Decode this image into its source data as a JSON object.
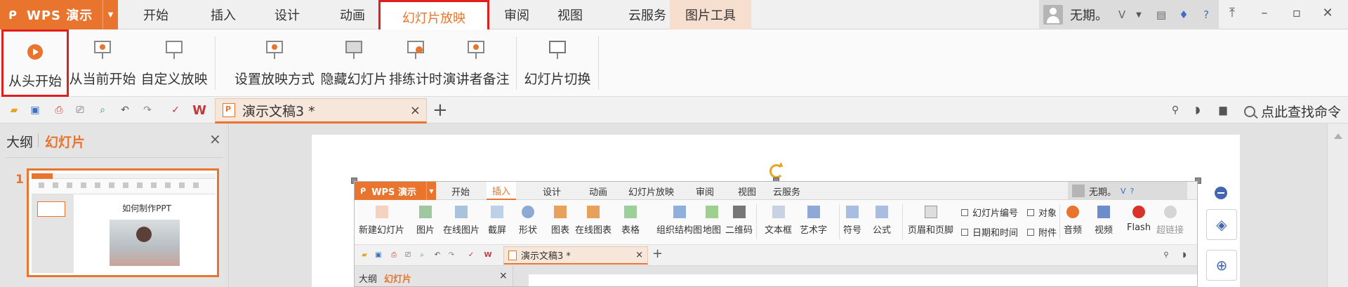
{
  "app": {
    "name": "WPS 演示",
    "logo": "wps-logo-icon"
  },
  "menu": {
    "tabs": [
      {
        "label": "开始"
      },
      {
        "label": "插入"
      },
      {
        "label": "设计"
      },
      {
        "label": "动画"
      },
      {
        "label": "幻灯片放映",
        "active": true
      },
      {
        "label": "审阅"
      },
      {
        "label": "视图"
      },
      {
        "label": "云服务"
      },
      {
        "label": "图片工具",
        "contextual": true
      }
    ]
  },
  "user": {
    "name": "无期。"
  },
  "ribbon": {
    "buttons": [
      {
        "label": "从头开始",
        "icon": "play-circle-icon",
        "highlighted": true
      },
      {
        "label": "从当前开始",
        "icon": "play-from-current-icon"
      },
      {
        "label": "自定义放映",
        "icon": "custom-show-icon"
      },
      {
        "label": "设置放映方式",
        "icon": "setup-show-icon"
      },
      {
        "label": "隐藏幻灯片",
        "icon": "hide-slide-icon"
      },
      {
        "label": "排练计时",
        "icon": "rehearse-timing-icon"
      },
      {
        "label": "演讲者备注",
        "icon": "speaker-notes-icon"
      },
      {
        "label": "幻灯片切换",
        "icon": "slide-transition-icon"
      }
    ]
  },
  "document": {
    "tab_title": "演示文稿3 *",
    "close_glyph": "×",
    "add_glyph": "+"
  },
  "search": {
    "placeholder": "点此查找命令"
  },
  "left_panel": {
    "tab_outline": "大纲",
    "tab_slides": "幻灯片",
    "close_glyph": "×",
    "slide_number": "1",
    "thumbnail_title": "如何制作PPT"
  },
  "embedded_screenshot": {
    "app_name": "WPS 演示",
    "tabs": [
      "开始",
      "插入",
      "设计",
      "动画",
      "幻灯片放映",
      "审阅",
      "视图",
      "云服务"
    ],
    "active_tab": "插入",
    "user_name": "无期。",
    "ribbon_buttons": [
      "新建幻灯片",
      "图片",
      "在线图片",
      "截屏",
      "形状",
      "图表",
      "在线图表",
      "表格",
      "组织结构图",
      "地图",
      "二维码",
      "文本框",
      "艺术字",
      "符号",
      "公式",
      "页眉和页脚"
    ],
    "ribbon_small": [
      "幻灯片编号",
      "对象",
      "日期和时间",
      "附件"
    ],
    "ribbon_media": [
      "音频",
      "视频",
      "Flash",
      "超链接"
    ],
    "doc_tab": "演示文稿3 *",
    "left_tab_outline": "大纲",
    "left_tab_slides": "幻灯片"
  },
  "colors": {
    "accent": "#e9742e",
    "highlight_box": "#e01e1e",
    "icon_blue": "#3a6fc4"
  }
}
